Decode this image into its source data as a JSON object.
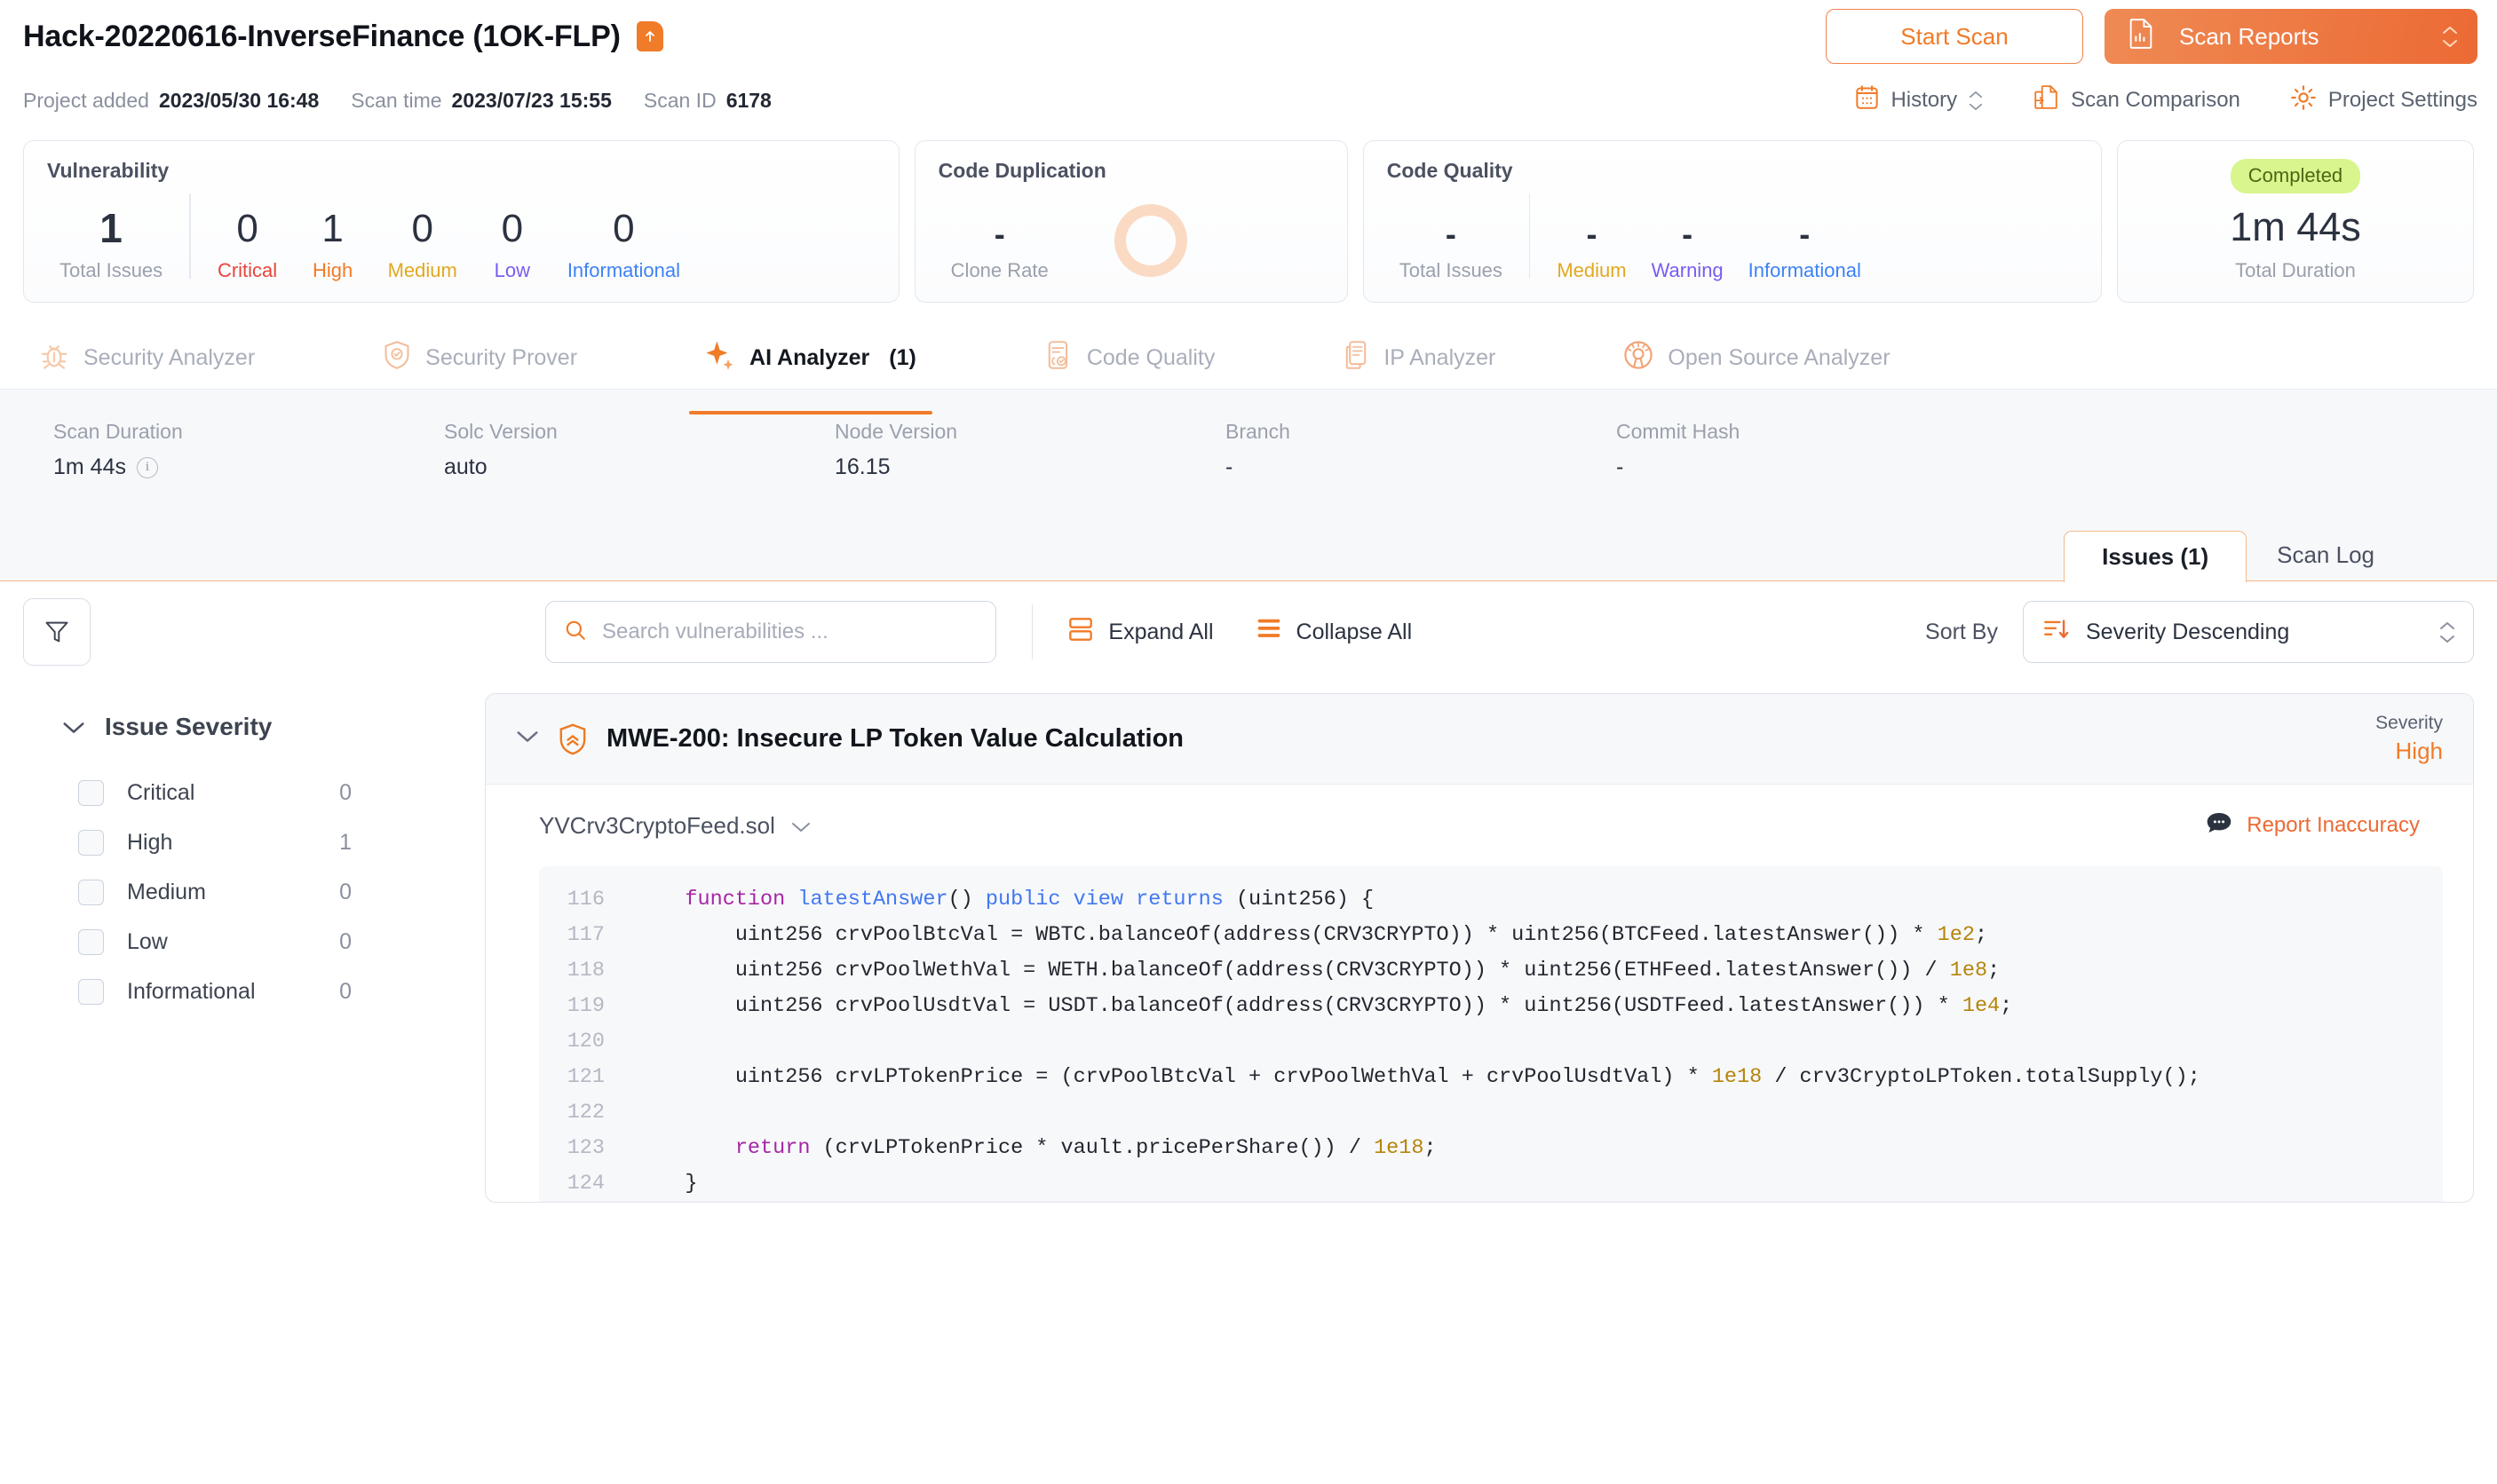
{
  "header": {
    "project_title": "Hack-20220616-InverseFinance (1OK-FLP)",
    "upload_icon": "upload-file-icon",
    "start_scan_label": "Start Scan",
    "scan_reports_label": "Scan Reports",
    "scan_reports_icon": "report-document-icon"
  },
  "meta": {
    "project_added_label": "Project added",
    "project_added_value": "2023/05/30 16:48",
    "scan_time_label": "Scan time",
    "scan_time_value": "2023/07/23 15:55",
    "scan_id_label": "Scan ID",
    "scan_id_value": "6178",
    "links": [
      {
        "label": "History",
        "icon": "calendar-icon",
        "has_stepper": true
      },
      {
        "label": "Scan Comparison",
        "icon": "compare-documents-icon",
        "has_stepper": false
      },
      {
        "label": "Project Settings",
        "icon": "gear-icon",
        "has_stepper": false
      }
    ]
  },
  "cards": {
    "vulnerability": {
      "title": "Vulnerability",
      "total_value": "1",
      "total_label": "Total Issues",
      "breakdown": [
        {
          "label": "Critical",
          "value": "0",
          "color": "#E8453C"
        },
        {
          "label": "High",
          "value": "1",
          "color": "#F07B28"
        },
        {
          "label": "Medium",
          "value": "0",
          "color": "#E2A820"
        },
        {
          "label": "Low",
          "value": "0",
          "color": "#7A5CF0"
        },
        {
          "label": "Informational",
          "value": "0",
          "color": "#3C82F6"
        }
      ]
    },
    "duplication": {
      "title": "Code Duplication",
      "clone_value": "-",
      "clone_label": "Clone Rate",
      "donut_color": "#FADAC3"
    },
    "quality": {
      "title": "Code Quality",
      "total_value": "-",
      "total_label": "Total Issues",
      "breakdown": [
        {
          "label": "Medium",
          "value": "-",
          "color": "#E2A820"
        },
        {
          "label": "Warning",
          "value": "-",
          "color": "#7A5CF0"
        },
        {
          "label": "Informational",
          "value": "-",
          "color": "#3C82F6"
        }
      ]
    },
    "duration": {
      "status_badge": "Completed",
      "value": "1m 44s",
      "label": "Total Duration",
      "badge_bg": "#D9F58E"
    }
  },
  "analyzers": [
    {
      "label": "Security Analyzer",
      "icon": "bug-icon",
      "count": "",
      "active": false
    },
    {
      "label": "Security Prover",
      "icon": "shield-check-icon",
      "count": "",
      "active": false
    },
    {
      "label": "AI Analyzer",
      "icon": "sparkle-icon",
      "count": "(1)",
      "active": true
    },
    {
      "label": "Code Quality",
      "icon": "code-quality-icon",
      "count": "",
      "active": false
    },
    {
      "label": "IP Analyzer",
      "icon": "documents-icon",
      "count": "",
      "active": false
    },
    {
      "label": "Open Source Analyzer",
      "icon": "open-source-icon",
      "count": "",
      "active": false
    }
  ],
  "scan_meta": [
    {
      "label": "Scan Duration",
      "value": "1m 44s",
      "info": true
    },
    {
      "label": "Solc Version",
      "value": "auto",
      "info": false
    },
    {
      "label": "Node Version",
      "value": "16.15",
      "info": false
    },
    {
      "label": "Branch",
      "value": "-",
      "info": false
    },
    {
      "label": "Commit Hash",
      "value": "-",
      "info": false
    }
  ],
  "issue_tabs": [
    {
      "label": "Issues (1)",
      "active": true
    },
    {
      "label": "Scan Log",
      "active": false
    }
  ],
  "toolbar": {
    "filter_icon": "filter-funnel-icon",
    "search_placeholder": "Search vulnerabilities ...",
    "search_value": "",
    "expand_all_label": "Expand All",
    "collapse_all_label": "Collapse All",
    "sort_by_label": "Sort By",
    "sort_value": "Severity Descending"
  },
  "sidebar": {
    "section_title": "Issue Severity",
    "rows": [
      {
        "label": "Critical",
        "count": "0",
        "checked": false
      },
      {
        "label": "High",
        "count": "1",
        "checked": false
      },
      {
        "label": "Medium",
        "count": "0",
        "checked": false
      },
      {
        "label": "Low",
        "count": "0",
        "checked": false
      },
      {
        "label": "Informational",
        "count": "0",
        "checked": false
      }
    ]
  },
  "issue": {
    "title": "MWE-200: Insecure LP Token Value Calculation",
    "severity_label": "Severity",
    "severity_value": "High",
    "severity_color": "#F07B28",
    "file_name": "YVCrv3CryptoFeed.sol",
    "report_label": "Report Inaccuracy",
    "code": [
      {
        "num": "116",
        "tokens": [
          {
            "t": "    ",
            "c": ""
          },
          {
            "t": "function ",
            "c": "k-key"
          },
          {
            "t": "latestAnswer",
            "c": "k-mod"
          },
          {
            "t": "() ",
            "c": ""
          },
          {
            "t": "public view returns",
            "c": "k-mod"
          },
          {
            "t": " (uint256) {",
            "c": ""
          }
        ]
      },
      {
        "num": "117",
        "tokens": [
          {
            "t": "        uint256 crvPoolBtcVal = WBTC.balanceOf(address(CRV3CRYPTO)) * uint256(BTCFeed.latestAnswer()) * ",
            "c": ""
          },
          {
            "t": "1e2",
            "c": "k-num"
          },
          {
            "t": ";",
            "c": ""
          }
        ]
      },
      {
        "num": "118",
        "tokens": [
          {
            "t": "        uint256 crvPoolWethVal = WETH.balanceOf(address(CRV3CRYPTO)) * uint256(ETHFeed.latestAnswer()) / ",
            "c": ""
          },
          {
            "t": "1e8",
            "c": "k-num"
          },
          {
            "t": ";",
            "c": ""
          }
        ]
      },
      {
        "num": "119",
        "tokens": [
          {
            "t": "        uint256 crvPoolUsdtVal = USDT.balanceOf(address(CRV3CRYPTO)) * uint256(USDTFeed.latestAnswer()) * ",
            "c": ""
          },
          {
            "t": "1e4",
            "c": "k-num"
          },
          {
            "t": ";",
            "c": ""
          }
        ]
      },
      {
        "num": "120",
        "tokens": [
          {
            "t": "",
            "c": ""
          }
        ]
      },
      {
        "num": "121",
        "tokens": [
          {
            "t": "        uint256 crvLPTokenPrice = (crvPoolBtcVal + crvPoolWethVal + crvPoolUsdtVal) * ",
            "c": ""
          },
          {
            "t": "1e18",
            "c": "k-num"
          },
          {
            "t": " / crv3CryptoLPToken.totalSupply();",
            "c": ""
          }
        ]
      },
      {
        "num": "122",
        "tokens": [
          {
            "t": "",
            "c": ""
          }
        ]
      },
      {
        "num": "123",
        "tokens": [
          {
            "t": "        ",
            "c": ""
          },
          {
            "t": "return",
            "c": "k-key"
          },
          {
            "t": " (crvLPTokenPrice * vault.pricePerShare()) / ",
            "c": ""
          },
          {
            "t": "1e18",
            "c": "k-num"
          },
          {
            "t": ";",
            "c": ""
          }
        ]
      },
      {
        "num": "124",
        "tokens": [
          {
            "t": "    }",
            "c": ""
          }
        ]
      }
    ]
  }
}
